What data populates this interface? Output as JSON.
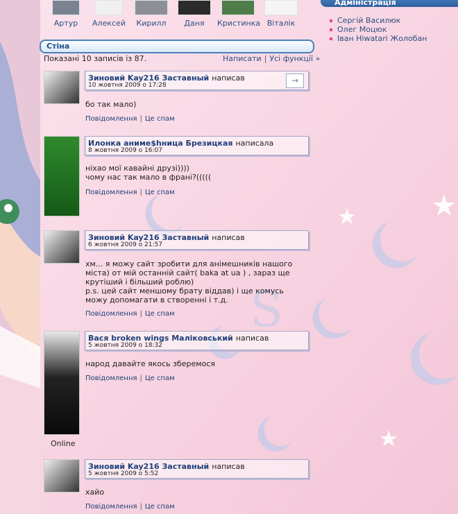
{
  "friends": [
    "Артур",
    "Алексей",
    "Кирилл",
    "Даня",
    "Кристинка",
    "Віталік"
  ],
  "sidebar": {
    "title": "Адміністрація",
    "admins": [
      "Сергій Василюк",
      "Олег Моцюк",
      "Іван Hiwatari Жолобан"
    ]
  },
  "wall": {
    "title": "Стіна",
    "shown": "Показані 10 записів із 87.",
    "write": "Написати",
    "all_functions": "Усі функції »"
  },
  "post_links": {
    "messages": "Повідомлення",
    "spam": "Це спам"
  },
  "posts": [
    {
      "author": "Зиновий Kay216 Заставный",
      "verb": "написав",
      "date": "10 жовтня 2009 о 17:28",
      "text": "бо так мало)"
    },
    {
      "author": "Илонка аниме$hница Брезицкая",
      "verb": "написала",
      "date": "8 жовтня 2009 о 16:07",
      "text": "ніхао мої кавайні друзі))))\nчому нас так мало в франі?((((("
    },
    {
      "author": "Зиновий Kay216 Заставный",
      "verb": "написав",
      "date": "6 жовтня 2009 о 21:57",
      "text": "хм... я можу сайт зробити для анімешників нашого міста) от мій останній сайт( baka at ua ) , зараз ще крутіший і більший роблю)\np.s. цей сайт меншому брату віддав) і ще комусь можу допомагати в створенні і т.д."
    },
    {
      "author": "Вася broken wings Маліковський",
      "verb": "написав",
      "date": "5 жовтня 2009 о 18:32",
      "text": "народ давайте якось зберемося",
      "status": "Online"
    },
    {
      "author": "Зиновий Kay216 Заставный",
      "verb": "написав",
      "date": "5 жовтня 2009 о 5:52",
      "text": "хайо"
    }
  ]
}
